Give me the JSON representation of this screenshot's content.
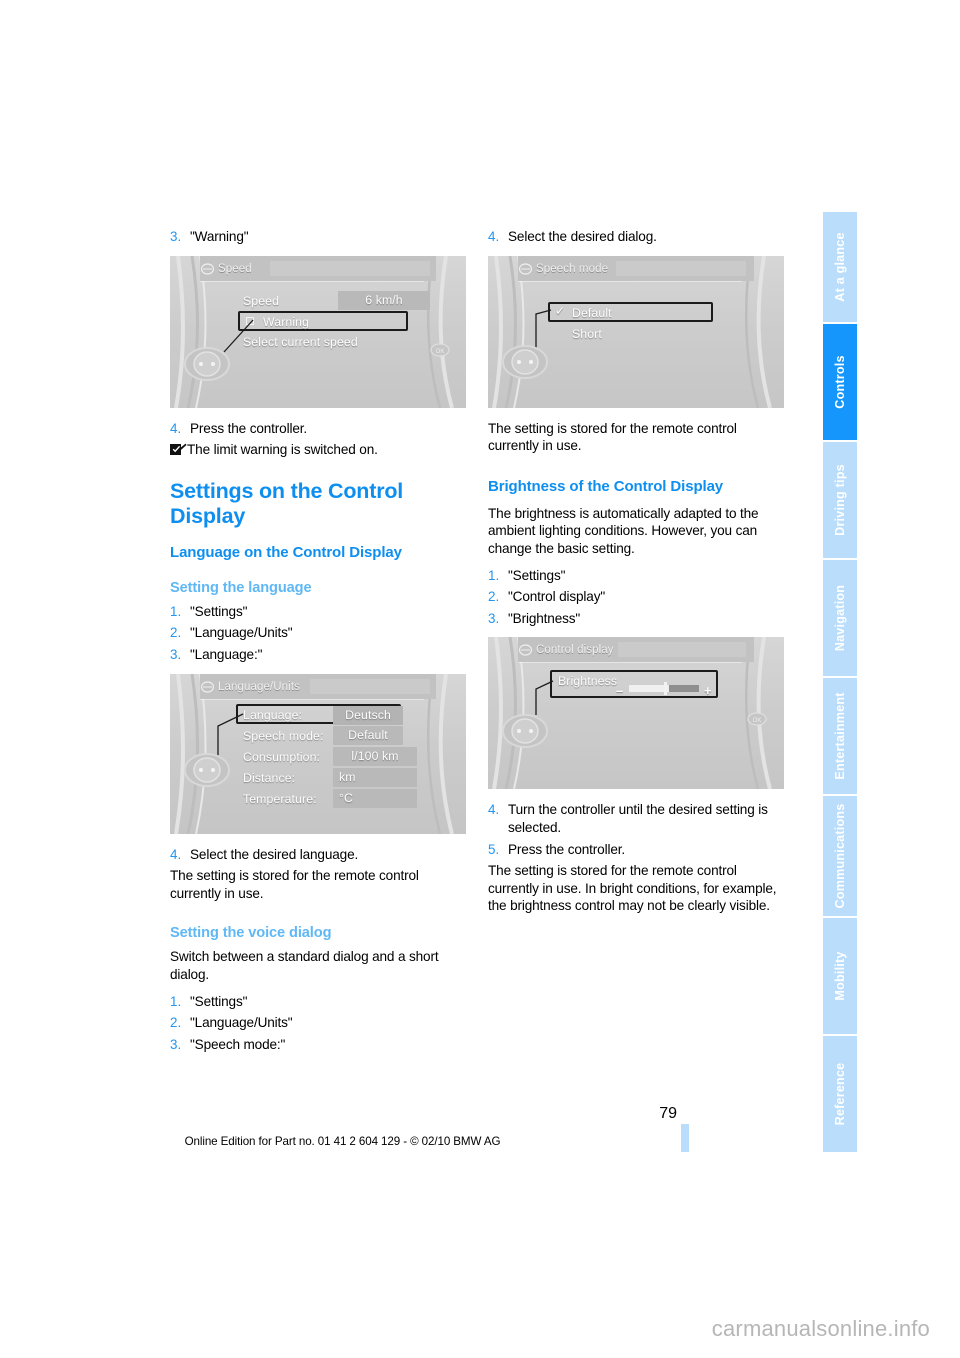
{
  "document": {
    "page_number": "79",
    "footer_text": "Online Edition for Part no. 01 41 2 604 129 - © 02/10 BMW AG",
    "watermark": "carmanualsonline.info"
  },
  "sidebar": {
    "tabs": [
      {
        "label": "At a glance",
        "active": false
      },
      {
        "label": "Controls",
        "active": true
      },
      {
        "label": "Driving tips",
        "active": false
      },
      {
        "label": "Navigation",
        "active": false
      },
      {
        "label": "Entertainment",
        "active": false
      },
      {
        "label": "Communications",
        "active": false
      },
      {
        "label": "Mobility",
        "active": false
      },
      {
        "label": "Reference",
        "active": false
      }
    ]
  },
  "left_column": {
    "step3": {
      "num": "3.",
      "text": "\"Warning\""
    },
    "screen_speed": {
      "title": "Speed",
      "row_label": "Speed",
      "row_value": "6 km/h",
      "selected_item": "Warning",
      "hint": "Select current speed"
    },
    "step4": {
      "num": "4.",
      "text": "Press the controller."
    },
    "check_note": "The limit warning is switched on.",
    "h1": "Settings on the Control Display",
    "h2": "Language on the Control Display",
    "h3_language": "Setting the language",
    "language_steps": [
      {
        "num": "1.",
        "text": "\"Settings\""
      },
      {
        "num": "2.",
        "text": "\"Language/Units\""
      },
      {
        "num": "3.",
        "text": "\"Language:\""
      }
    ],
    "screen_language": {
      "title": "Language/Units",
      "rows": [
        {
          "label": "Language:",
          "value": "Deutsch",
          "selected": true
        },
        {
          "label": "Speech mode:",
          "value": "Default",
          "selected": false
        },
        {
          "label": "Consumption:",
          "value": "l/100 km",
          "selected": false
        },
        {
          "label": "Distance:",
          "value": "km",
          "selected": false
        },
        {
          "label": "Temperature:",
          "value": "°C",
          "selected": false
        }
      ]
    },
    "step4_language": {
      "num": "4.",
      "text": "Select the desired language."
    },
    "stored_note": "The setting is stored for the remote control currently in use.",
    "h3_voice": "Setting the voice dialog",
    "voice_intro": "Switch between a standard dialog and a short dialog.",
    "voice_steps": [
      {
        "num": "1.",
        "text": "\"Settings\""
      },
      {
        "num": "2.",
        "text": "\"Language/Units\""
      },
      {
        "num": "3.",
        "text": "\"Speech mode:\""
      }
    ]
  },
  "right_column": {
    "step4": {
      "num": "4.",
      "text": "Select the desired dialog."
    },
    "screen_speech": {
      "title": "Speech mode",
      "selected_item": "Default",
      "second_item": "Short"
    },
    "stored_note": "The setting is stored for the remote control currently in use.",
    "h2_brightness": "Brightness of the Control Display",
    "brightness_intro": "The brightness is automatically adapted to the ambient lighting conditions. However, you can change the basic setting.",
    "brightness_steps": [
      {
        "num": "1.",
        "text": "\"Settings\""
      },
      {
        "num": "2.",
        "text": "\"Control display\""
      },
      {
        "num": "3.",
        "text": "\"Brightness\""
      }
    ],
    "screen_brightness": {
      "title": "Control display",
      "row_label": "Brightness",
      "minus": "–",
      "plus": "+"
    },
    "step4_brightness": {
      "num": "4.",
      "text": "Turn the controller until the desired setting is selected."
    },
    "step5_brightness": {
      "num": "5.",
      "text": "Press the controller."
    },
    "brightness_note": "The setting is stored for the remote control currently in use. In bright conditions, for example, the brightness control may not be clearly visible."
  },
  "colors": {
    "heading_blue": "#0e8ff0",
    "subheading_blue": "#5fb8f5",
    "step_number_blue": "#2196f3",
    "tab_inactive": "#b9ddfb",
    "tab_active": "#1596fc"
  }
}
